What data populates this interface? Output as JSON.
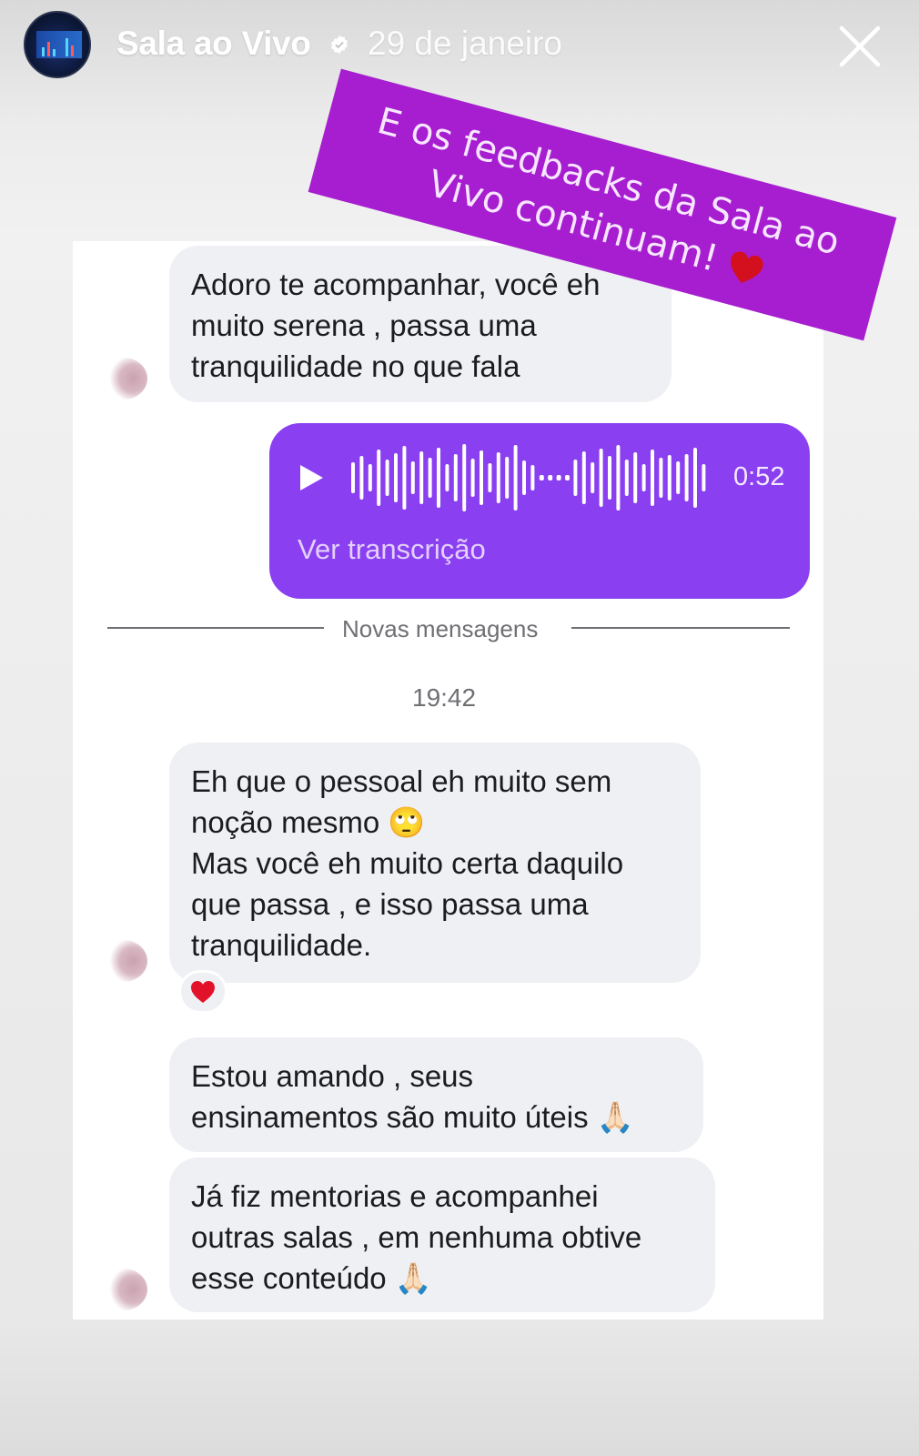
{
  "header": {
    "account_name": "Sala ao Vivo",
    "date": "29 de janeiro"
  },
  "sticker": {
    "line1": "E os feedbacks da Sala ao",
    "line2": "Vivo continuam!",
    "color": "#a61ecf"
  },
  "chat": {
    "messages": [
      {
        "text": "Adoro te acompanhar, você eh\nmuito serena , passa uma\ntranquilidade no que fala"
      },
      {
        "text": "Eh que o pessoal eh muito sem\nnoção mesmo 🙄\nMas você eh muito certa daquilo\nque passa , e isso passa uma\ntranquilidade."
      },
      {
        "text": "Estou amando , seus\nensinamentos são muito úteis 🙏🏻"
      },
      {
        "text": "Já fiz mentorias e acompanhei\noutras salas , em nenhuma obtive\nesse conteúdo 🙏🏻"
      }
    ],
    "audio": {
      "duration": "0:52",
      "transcript_link": "Ver transcrição",
      "color": "#8a3ff0"
    },
    "divider_label": "Novas mensagens",
    "timestamp": "19:42",
    "reaction_icon": "red-heart-icon"
  }
}
